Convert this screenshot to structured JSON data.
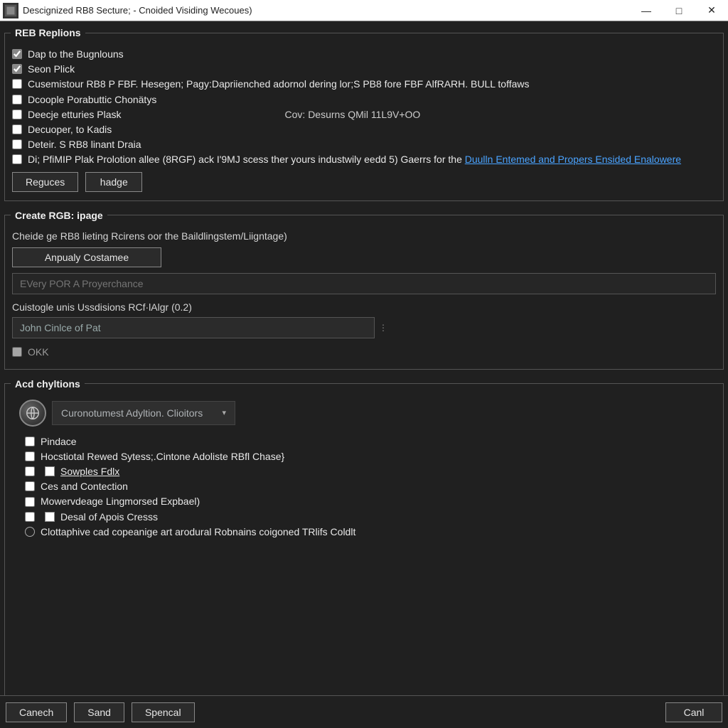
{
  "window": {
    "title": "Descignized RB8 Secture; - Cnoided Visiding Wecoues)"
  },
  "group1": {
    "legend": "REB Replions",
    "items": [
      {
        "label": "Dap to the Bugnlouns",
        "checked": true
      },
      {
        "label": "Seon Plick",
        "checked": true
      },
      {
        "label": "Cusemistour RB8 P FBF. Hesegen; Pagy:Dapriienched adornol dering lor;S PB8 fore FBF AlfRARH. BULL toffaws",
        "checked": false
      },
      {
        "label": "Dcoople Porabuttic Chonätys",
        "checked": false
      },
      {
        "label": "Deecje etturies Plask",
        "checked": false,
        "inline_text": "Cov: Desurns QMil 11L9V+OO"
      },
      {
        "label": "Decuoper, to Kadis",
        "checked": false
      },
      {
        "label": "Deteir. S RB8 linant Draia",
        "checked": false
      },
      {
        "label_prefix": "Di; PfiMIP Plak Prolotion allee (8RGF) ack I'9MJ scess ther yours industwily eedd 5) Gaerrs for the ",
        "link_text": "Duulln Entemed and Propers Ensided Enalowere",
        "checked": false,
        "has_link": true
      }
    ],
    "buttons": {
      "reguces": "Reguces",
      "hadge": "hadge"
    }
  },
  "group2": {
    "legend": "Create RGB: ipage",
    "desc": "Cheide ge RB8 lieting Rcirens oor the Baildlingstem/Liigntage)",
    "btn_anpualy": "Anpualy Costamee",
    "field1_placeholder": "EVery POR A Proyerchance",
    "sublabel": "Cuistogle unis Ussdisions RCf·lAlgr (0.2)",
    "field2_value": "John Cinlce of Pat",
    "okk": "OKK"
  },
  "group3": {
    "legend": "Acd chyltions",
    "dropdown_value": "Curonotumest Adyltion. Clioitors",
    "items": [
      {
        "label": "Pindace"
      },
      {
        "label": "Hocstiotal Rewed Sytess;.Cintone Adoliste RBfl Chase}"
      },
      {
        "label": "Sowples Fdlx",
        "underline": true,
        "extra_box": true
      },
      {
        "label": "Ces and Contection"
      },
      {
        "label": "Mowervdeage Lingmorsed Expbael)"
      },
      {
        "label": "Desal of Apois Cresss",
        "extra_box": true
      }
    ],
    "radio_label": "Clottaphive cad copeanige art arodural Robnains coigoned TRlifs Coldlt"
  },
  "footer": {
    "canech": "Canech",
    "sand": "Sand",
    "spencal": "Spencal",
    "canl": "Canl"
  }
}
